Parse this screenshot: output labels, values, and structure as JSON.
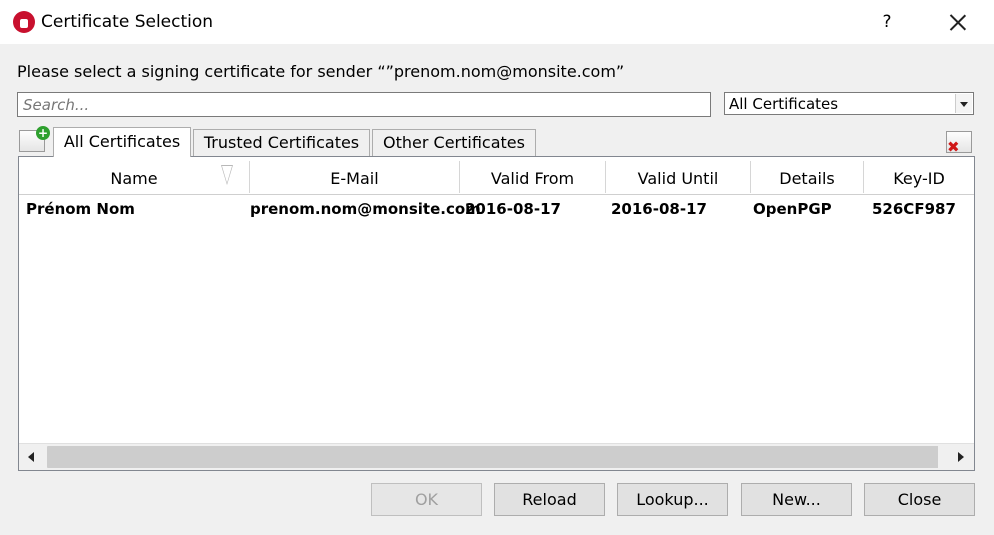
{
  "window": {
    "title": "Certificate Selection",
    "help": "?"
  },
  "prompt": "Please select a signing certificate for sender “”prenom.nom@monsite.com”",
  "search": {
    "placeholder": "Search...",
    "value": ""
  },
  "filter": {
    "selected": "All Certificates"
  },
  "tabs": [
    {
      "label": "All Certificates",
      "active": true
    },
    {
      "label": "Trusted Certificates",
      "active": false
    },
    {
      "label": "Other Certificates",
      "active": false
    }
  ],
  "table": {
    "columns": [
      "Name",
      "E-Mail",
      "Valid From",
      "Valid Until",
      "Details",
      "Key-ID"
    ],
    "rows": [
      [
        "Prénom Nom",
        "prenom.nom@monsite.com",
        "2016-08-17",
        "2016-08-17",
        "OpenPGP",
        "526CF987"
      ]
    ]
  },
  "buttons": {
    "ok": "OK",
    "reload": "Reload",
    "lookup": "Lookup...",
    "new": "New...",
    "close": "Close"
  }
}
